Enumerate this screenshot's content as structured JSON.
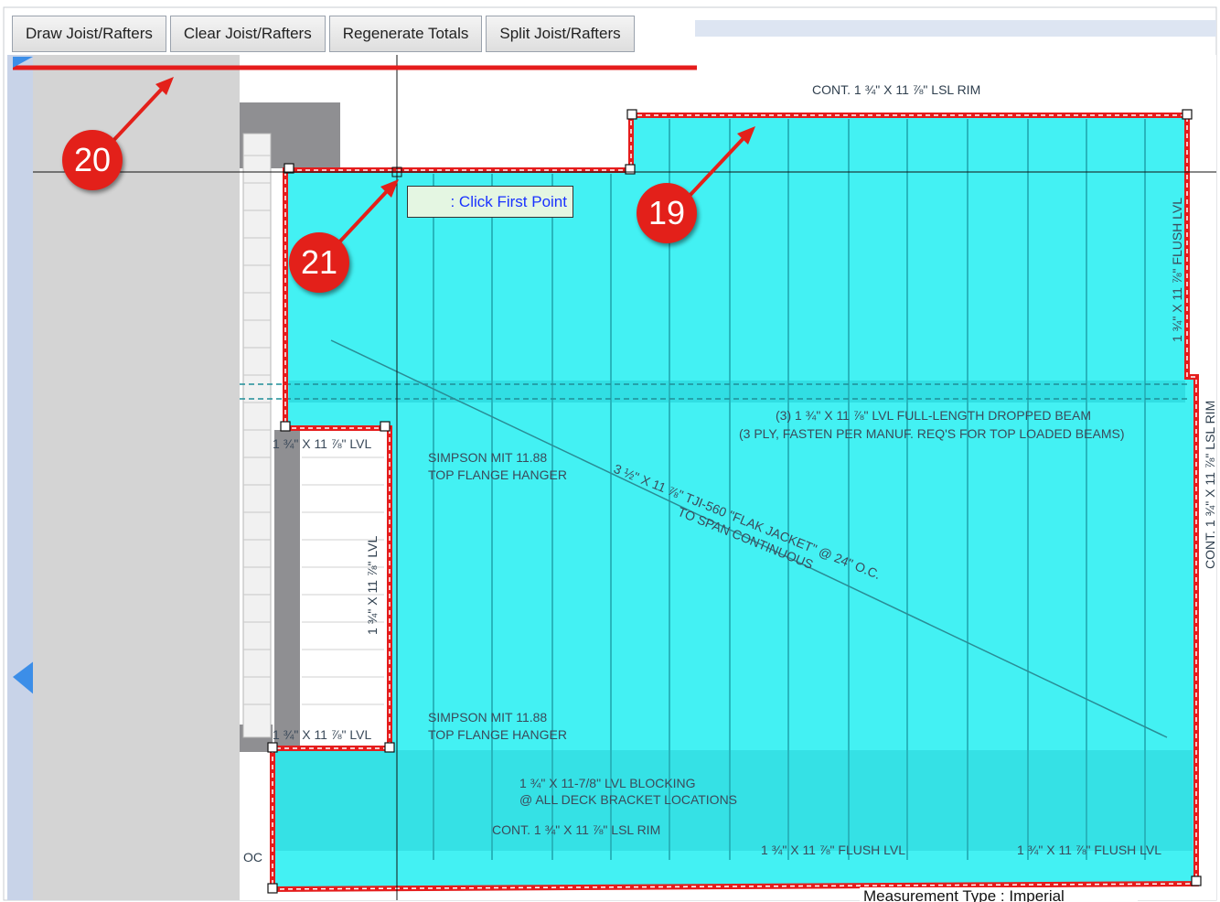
{
  "toolbar": {
    "draw_label": "Draw Joist/Rafters",
    "clear_label": "Clear Joist/Rafters",
    "regenerate_label": "Regenerate Totals",
    "split_label": "Split Joist/Rafters"
  },
  "tooltip": {
    "text": ": Click First Point"
  },
  "callouts": {
    "c19": "19",
    "c20": "20",
    "c21": "21"
  },
  "plan_labels": {
    "top_rim": "CONT. 1 ¾\" X 11 ⅞\" LSL RIM",
    "dropped_beam_1": "(3) 1 ¾\" X 11 ⅞\" LVL FULL-LENGTH DROPPED BEAM",
    "dropped_beam_2": "(3 PLY, FASTEN PER MANUF. REQ'S FOR TOP LOADED BEAMS)",
    "hanger_1_line1": "SIMPSON MIT 11.88",
    "hanger_1_line2": "TOP FLANGE HANGER",
    "hanger_2_line1": "SIMPSON MIT 11.88",
    "hanger_2_line2": "TOP FLANGE HANGER",
    "lvl_top": "1 ¾\" X 11 ⅞\" LVL",
    "lvl_bottom": "1 ¾\" X 11 ⅞\" LVL",
    "lvl_vertical": "1 ¾\" X 11 ⅞\" LVL",
    "joist_line1": "3 ½\" X 11 ⅞\" TJI-560 \"FLAK JACKET\" @ 24\" O.C.",
    "joist_line2": "TO SPAN CONTINUOUS",
    "blocking_line1": "1 ¾\" X 11-7/8\" LVL BLOCKING",
    "blocking_line2": "@ ALL DECK BRACKET LOCATIONS",
    "bottom_rim": "CONT. 1 ¾\" X 11 ⅞\" LSL RIM",
    "flush_lvl_1": "1 ¾\" X 11 ⅞\" FLUSH LVL",
    "flush_lvl_2": "1 ¾\" X 11 ⅞\" FLUSH LVL",
    "flush_lvl_vertical": "1 ¾\" X 11 ⅞\" FLUSH LVL",
    "right_rim_vertical": "CONT. 1 ¾\" X 11 ⅞\" LSL RIM",
    "oc_tag": "OC"
  },
  "status": {
    "text": "Measurement Type : Imperial"
  },
  "colors": {
    "fill": "#33f0f2",
    "outline": "#e51c1c",
    "callout": "#e3201a",
    "tooltip_bg": "#e4f6e2"
  }
}
